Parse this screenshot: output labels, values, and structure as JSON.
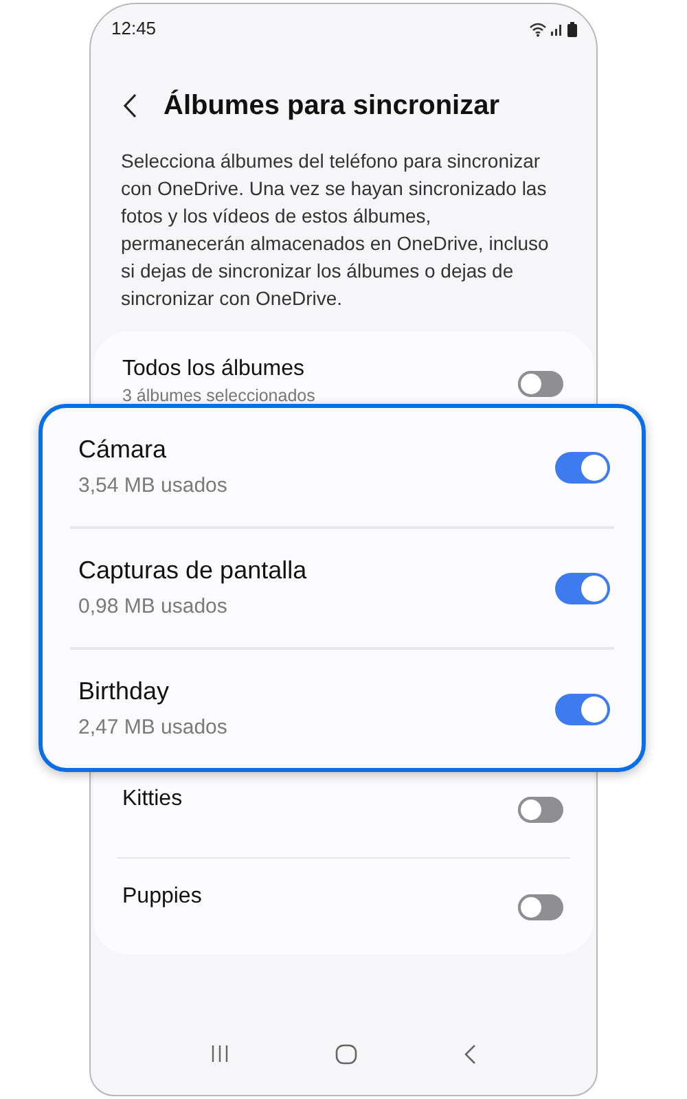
{
  "status_bar": {
    "time": "12:45"
  },
  "header": {
    "title": "Álbumes para sincronizar"
  },
  "description": "Selecciona álbumes del teléfono para sincronizar con OneDrive. Una vez se hayan sincronizado las fotos y los vídeos de estos álbumes, permanecerán almacenados en OneDrive, incluso si dejas de sincronizar los álbumes o dejas de sincronizar con OneDrive.",
  "all_albums": {
    "title": "Todos los álbumes",
    "subtitle": "3 álbumes seleccionados",
    "on": false
  },
  "highlighted_albums": [
    {
      "title": "Cámara",
      "subtitle": "3,54 MB usados",
      "on": true
    },
    {
      "title": "Capturas de pantalla",
      "subtitle": "0,98 MB usados",
      "on": true
    },
    {
      "title": "Birthday",
      "subtitle": "2,47 MB usados",
      "on": true
    }
  ],
  "other_albums": [
    {
      "title": "Kitties",
      "on": false
    },
    {
      "title": "Puppies",
      "on": false
    }
  ]
}
